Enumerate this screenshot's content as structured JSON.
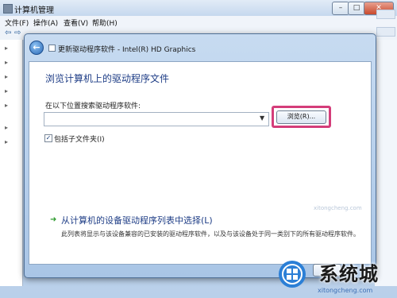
{
  "background_window": {
    "title": "计算机管理",
    "menu": [
      "文件(F)",
      "操作(A)",
      "查看(V)",
      "帮助(H)"
    ],
    "controls": {
      "minimize": "–",
      "maximize": "□",
      "close": "✕"
    },
    "icons": {
      "back": "arrow-left-icon",
      "forward": "arrow-right-icon"
    }
  },
  "dialog": {
    "title": "更新驱动程序软件 - Intel(R) HD Graphics",
    "back_icon": "back-arrow-icon",
    "heading": "浏览计算机上的驱动程序文件",
    "location_label": "在以下位置搜索驱动程序软件:",
    "path_value": "",
    "browse_label": "浏览(R)...",
    "highlight_color": "#d43d7a",
    "include_subfolders_label": "包括子文件夹(I)",
    "include_subfolders_checked": true,
    "pick_link": "从计算机的设备驱动程序列表中选择(L)",
    "pick_description": "此列表将显示与该设备兼容的已安装的驱动程序软件，以及与该设备处于同一类别下的所有驱动程序软件。"
  },
  "watermark": {
    "url_top": "xitongcheng.com",
    "text": "系统城",
    "url": "xitongcheng.com"
  }
}
